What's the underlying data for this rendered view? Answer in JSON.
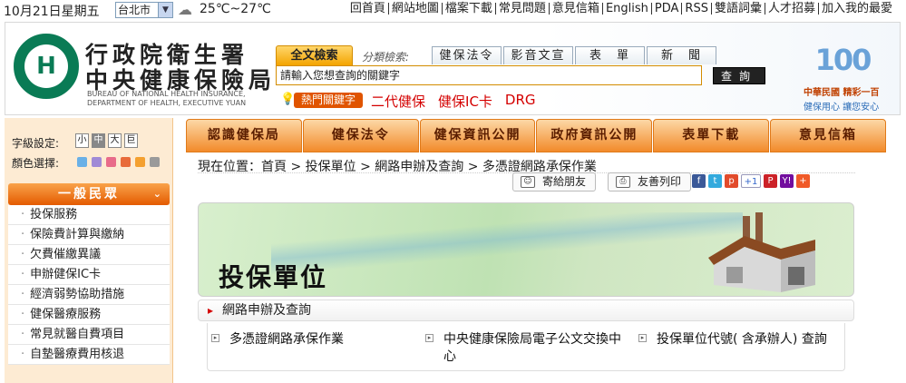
{
  "topbar": {
    "date": "10月21日星期五",
    "city": "台北市",
    "temperature": "25℃~27℃",
    "links": [
      "回首頁",
      "網站地圖",
      "檔案下載",
      "常見問題",
      "意見信箱",
      "English",
      "PDA",
      "RSS",
      "雙語詞彙",
      "人才招募",
      "加入我的最愛"
    ]
  },
  "header": {
    "org_line1": "行政院衛生署",
    "org_line2": "中央健康保險局",
    "org_en1": "BUREAU OF NATIONAL HEALTH INSURANCE,",
    "org_en2": "DEPARTMENT OF HEALTH, EXECUTIVE YUAN",
    "logo_text": "H",
    "badge_number": "100",
    "slogan1": "中華民國 精彩一百",
    "slogan2": "健保用心 讓您安心"
  },
  "search": {
    "full_tab": "全文檢索",
    "category_label": "分類檢索:",
    "category_tabs": [
      "健保法令",
      "影音文宣",
      "表　單",
      "新　聞"
    ],
    "placeholder": "請輸入您想查詢的關鍵字",
    "button": "查詢",
    "hot_label": "熱門關鍵字",
    "hot_links": [
      "二代健保",
      "健保IC卡",
      "DRG"
    ]
  },
  "sidebar": {
    "font_size_label": "字級設定:",
    "font_sizes": [
      "小",
      "中",
      "大",
      "巨"
    ],
    "color_label": "顏色選擇:",
    "colors": [
      "#6ab0e6",
      "#a08ad6",
      "#e86b8a",
      "#e86b3a",
      "#f4a030",
      "#9a9a9a"
    ],
    "menu_title": "一般民眾",
    "menu_items": [
      "投保服務",
      "保險費計算與繳納",
      "欠費催繳異議",
      "申辦健保IC卡",
      "經濟弱勢協助措施",
      "健保醫療服務",
      "常見就醫自費項目",
      "自墊醫療費用核退"
    ]
  },
  "nav": {
    "items": [
      "認識健保局",
      "健保法令",
      "健保資訊公開",
      "政府資訊公開",
      "表單下載",
      "意見信箱"
    ]
  },
  "content": {
    "breadcrumb": "現在位置：首頁 > 投保單位 > 網路申辦及查詢 > 多憑證網路承保作業",
    "send_friend": "寄給朋友",
    "print": "友善列印",
    "banner_title": "投保單位",
    "section_title": "網路申辦及查詢",
    "links": [
      "多憑證網路承保作業",
      "中央健康保險局電子公文交換中心",
      "投保單位代號( 含承辦人) 查詢"
    ]
  },
  "social": [
    "f",
    "t",
    "p",
    "+1",
    "P",
    "Y!",
    "+"
  ]
}
